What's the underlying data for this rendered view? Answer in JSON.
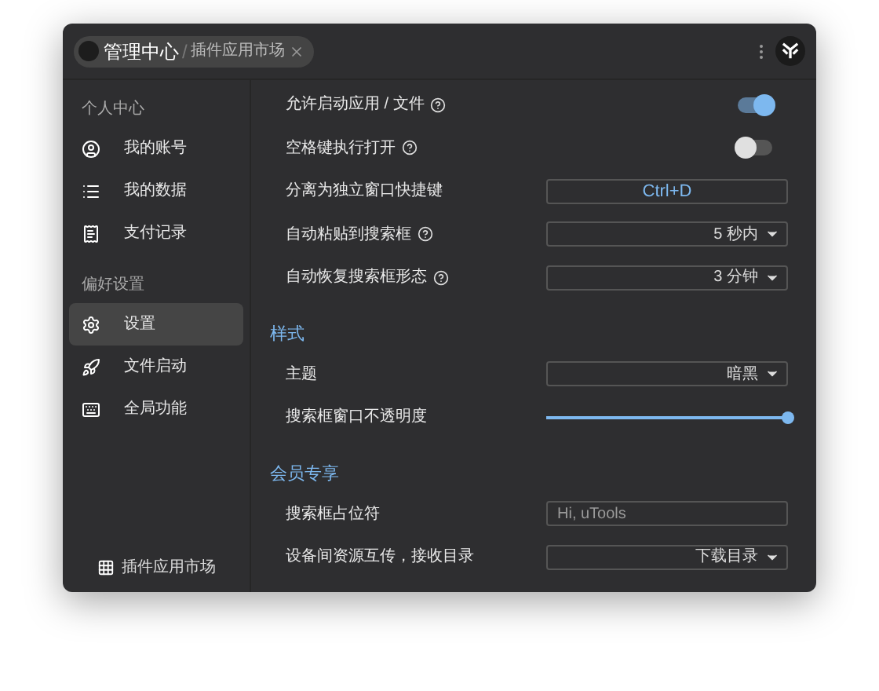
{
  "breadcrumb_separator": "/",
  "breadcrumb": [
    {
      "label": "管理中心",
      "selected": true
    },
    {
      "label": "插件应用市场",
      "selected": false
    }
  ],
  "sidebar": {
    "sections": [
      {
        "title": "个人中心",
        "items": [
          {
            "label": "我的账号",
            "selected": false
          },
          {
            "label": "我的数据",
            "selected": false
          },
          {
            "label": "支付记录",
            "selected": false
          }
        ]
      },
      {
        "title": "偏好设置",
        "items": [
          {
            "label": "设置",
            "selected": true
          },
          {
            "label": "文件启动",
            "selected": false
          },
          {
            "label": "全局功能",
            "selected": false
          }
        ]
      }
    ],
    "footer": "插件应用市场"
  },
  "groups": [
    {
      "rows": [
        {
          "kind": "toggle",
          "label": "允许启动应用 / 文件",
          "help": true,
          "on": true
        },
        {
          "kind": "toggle",
          "label": "空格键执行打开",
          "help": true,
          "on": false
        },
        {
          "kind": "key",
          "label": "分离为独立窗口快捷键",
          "help": false,
          "value": "Ctrl+D"
        },
        {
          "kind": "select",
          "label": "自动粘贴到搜索框",
          "help": true,
          "value": "5 秒内"
        },
        {
          "kind": "select",
          "label": "自动恢复搜索框形态",
          "help": true,
          "value": "3 分钟"
        }
      ]
    },
    {
      "title": "样式",
      "rows": [
        {
          "kind": "select",
          "label": "主题",
          "help": false,
          "value": "暗黑"
        },
        {
          "kind": "slider",
          "label": "搜索框窗口不透明度",
          "help": false,
          "level": 1
        }
      ]
    },
    {
      "title": "会员专享",
      "rows": [
        {
          "kind": "input",
          "label": "搜索框占位符",
          "help": false,
          "placeholder": "Hi, uTools"
        },
        {
          "kind": "select",
          "label": "设备间资源互传，接收目录",
          "help": false,
          "value": "下载目录"
        }
      ]
    }
  ]
}
